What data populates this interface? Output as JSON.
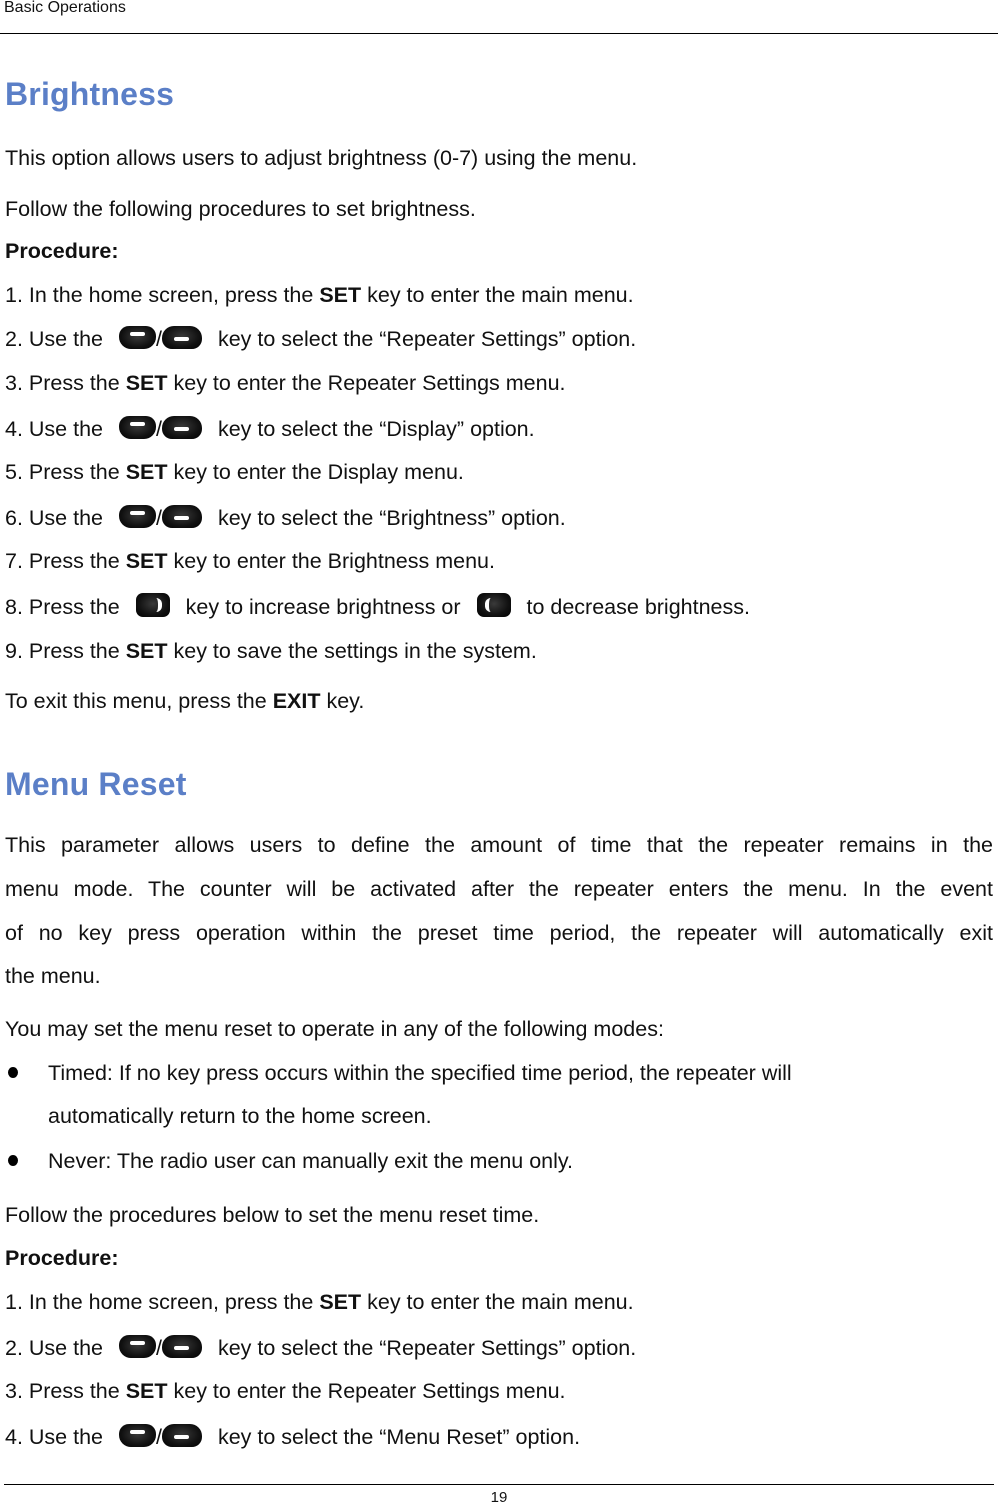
{
  "header": {
    "running_head": "Basic Operations"
  },
  "footer": {
    "page_number": "19"
  },
  "brightness": {
    "title": "Brightness",
    "intro": "This option allows users to adjust brightness (0-7) using the menu.",
    "follow": "Follow the following procedures to set brightness.",
    "procedure_label": "Procedure:",
    "steps": [
      {
        "pre": "1. In the home screen, press the ",
        "bold": "SET",
        "post": " key to enter the main menu."
      },
      {
        "pre": "2. Use the ",
        "sep": "/",
        "post": " key to select the “Repeater Settings” option."
      },
      {
        "pre": "3. Press the ",
        "bold": "SET",
        "post": " key to enter the Repeater Settings menu."
      },
      {
        "pre": "4. Use the ",
        "sep": "/",
        "post": " key to select the “Display” option."
      },
      {
        "pre": "5. Press the ",
        "bold": "SET",
        "post": " key to enter the Display menu."
      },
      {
        "pre": "6. Use the ",
        "sep": "/",
        "post": " key to select the “Brightness” option."
      },
      {
        "pre": "7. Press the ",
        "bold": "SET",
        "post": " key to enter the Brightness menu."
      },
      {
        "pre": "8. Press the ",
        "mid": " key to increase brightness or ",
        "post": " to decrease brightness."
      },
      {
        "pre": "9. Press the ",
        "bold": "SET",
        "post": " key to save the settings in the system."
      }
    ],
    "exit": {
      "pre": "To exit this menu, press the ",
      "bold": "EXIT",
      "post": " key."
    }
  },
  "menu_reset": {
    "title": "Menu Reset",
    "para_lines": [
      "This parameter allows users to define the amount of time that the repeater remains in the",
      "menu mode. The counter will be activated after the repeater enters the menu. In the event",
      "of no key press operation within the preset time period, the repeater will automatically exit",
      "the menu."
    ],
    "modes_intro": "You may set the menu reset to operate in any of the following modes:",
    "modes": [
      {
        "line1": "Timed: If no key press occurs within the specified time period, the repeater will",
        "line2": "automatically return to the home screen."
      },
      {
        "line1": "Never: The radio user can manually exit the menu only."
      }
    ],
    "follow": "Follow the procedures below to set the menu reset time.",
    "procedure_label": "Procedure:",
    "steps": [
      {
        "pre": "1. In the home screen, press the ",
        "bold": "SET",
        "post": " key to enter the main menu."
      },
      {
        "pre": "2. Use the ",
        "sep": "/",
        "post": " key to select the “Repeater Settings” option."
      },
      {
        "pre": "3. Press the ",
        "bold": "SET",
        "post": " key to enter the Repeater Settings menu."
      },
      {
        "pre": "4. Use the ",
        "sep": "/",
        "post": " key to select the “Menu Reset” option."
      }
    ]
  },
  "icons": {
    "up_key": "up-key-icon",
    "down_key": "down-key-icon",
    "right_key": "right-key-icon",
    "left_key": "left-key-icon"
  },
  "colors": {
    "heading": "#5B7FC7",
    "text": "#111111"
  }
}
